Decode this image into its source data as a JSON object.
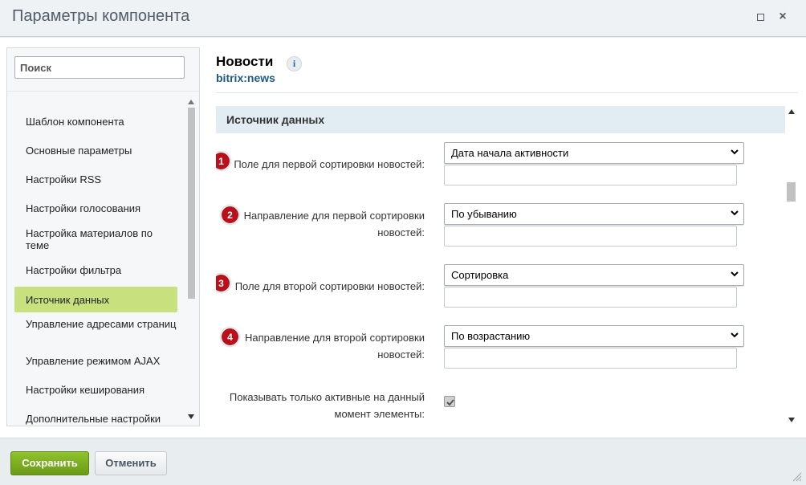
{
  "window": {
    "title": "Параметры компонента",
    "maximize_icon": "maximize-icon",
    "close_icon": "close-icon"
  },
  "sidebar": {
    "search_placeholder": "Поиск",
    "items": [
      {
        "label": "Шаблон компонента",
        "active": false
      },
      {
        "label": "Основные параметры",
        "active": false
      },
      {
        "label": "Настройки RSS",
        "active": false
      },
      {
        "label": "Настройки голосования",
        "active": false
      },
      {
        "label": "Настройка материалов по теме",
        "active": false
      },
      {
        "label": "Настройки фильтра",
        "active": false
      },
      {
        "label": "Источник данных",
        "active": true
      },
      {
        "label": "Управление адресами страниц",
        "active": false
      },
      {
        "label": "Управление режимом AJAX",
        "active": false
      },
      {
        "label": "Настройки кеширования",
        "active": false
      },
      {
        "label": "Дополнительные настройки",
        "active": false
      }
    ]
  },
  "component": {
    "title": "Новости",
    "code": "bitrix:news",
    "info_icon_glyph": "i"
  },
  "section": {
    "title": "Источник данных",
    "fields": [
      {
        "badge": "1",
        "label": "Поле для первой сортировки новостей:",
        "value": "Дата начала активности",
        "text_value": ""
      },
      {
        "badge": "2",
        "label": "Направление для первой сортировки новостей:",
        "value": "По убыванию",
        "text_value": ""
      },
      {
        "badge": "3",
        "label": "Поле для второй сортировки новостей:",
        "value": "Сортировка",
        "text_value": ""
      },
      {
        "badge": "4",
        "label": "Направление для второй сортировки новостей:",
        "value": "По возрастанию",
        "text_value": ""
      }
    ],
    "checkbox_field": {
      "label": "Показывать только активные на данный момент элементы:",
      "checked": true
    }
  },
  "footer": {
    "save_label": "Сохранить",
    "cancel_label": "Отменить"
  },
  "colors": {
    "accent_green": "#7cb51f",
    "active_item": "#c9e07f",
    "badge_red": "#b9101c",
    "link_blue": "#1d5b86",
    "section_bg": "#e2ecf3"
  }
}
